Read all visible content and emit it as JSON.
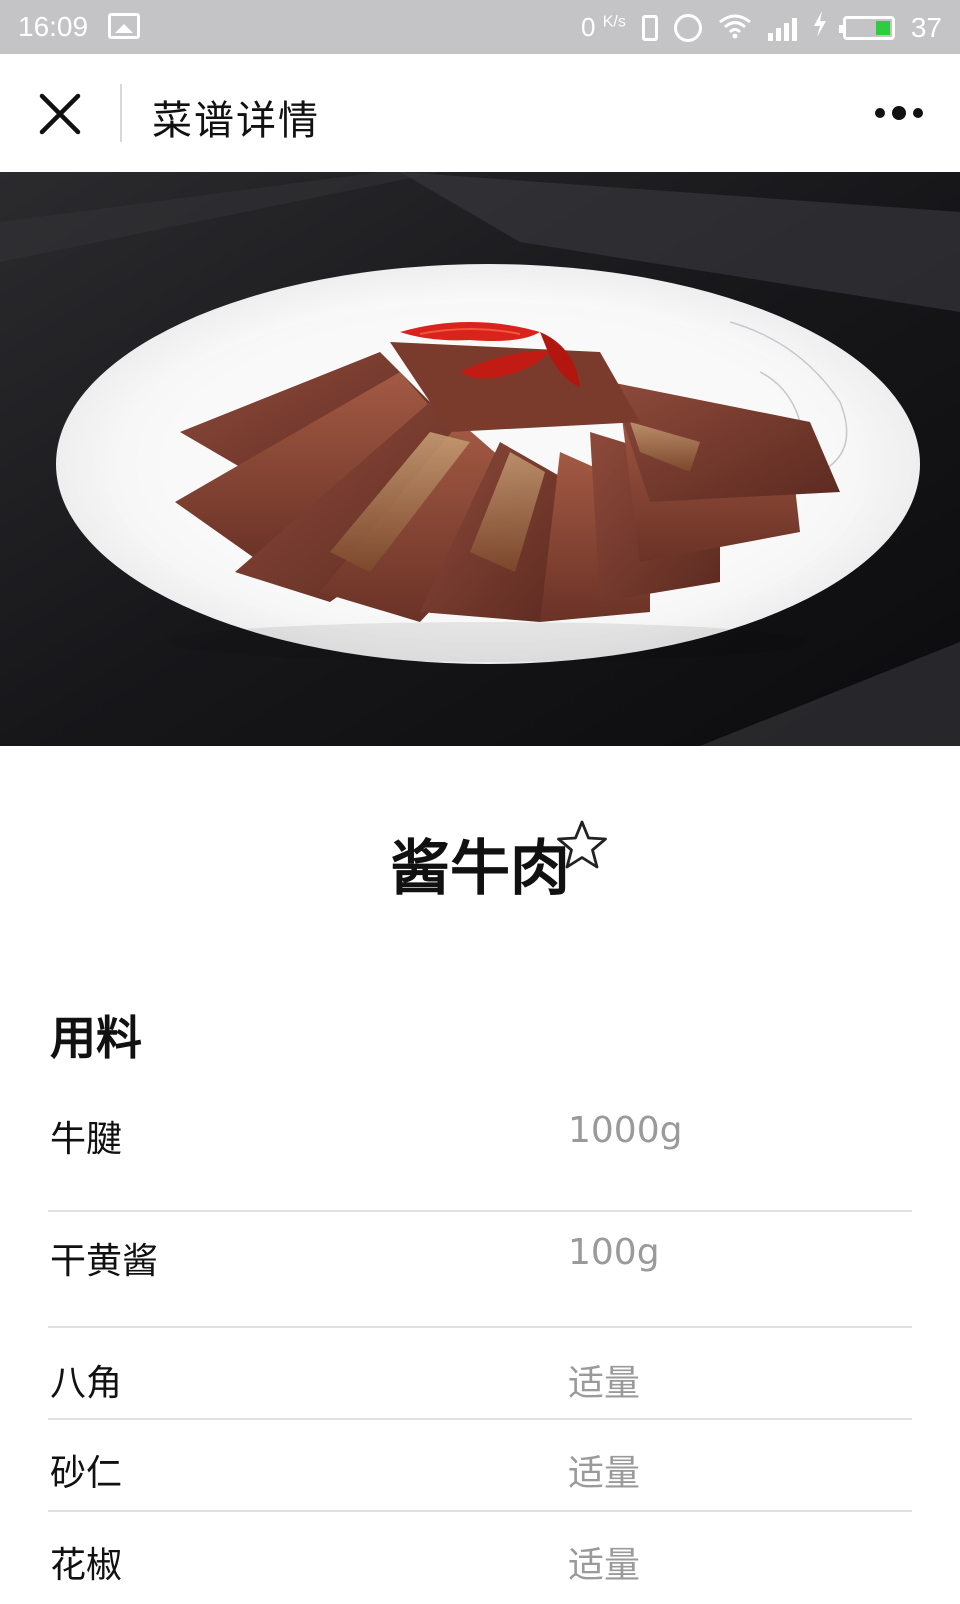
{
  "status_bar": {
    "time": "16:09",
    "net_speed": "0",
    "net_speed_unit": "K/s",
    "battery_level": "37",
    "icons": [
      "image-icon",
      "vibrate-icon",
      "alarm-icon",
      "wifi-icon",
      "signal-4g-icon",
      "charging-icon",
      "battery-icon"
    ]
  },
  "nav": {
    "title": "菜谱详情",
    "close_icon": "close-icon",
    "more_icon": "more-dots-icon"
  },
  "hero": {
    "image": "braised-beef-slices-photo"
  },
  "recipe": {
    "title": "酱牛肉",
    "favorite_icon": "star-outline-icon"
  },
  "ingredients": {
    "heading": "用料",
    "items": [
      {
        "name": "牛腱",
        "amount": "1000g"
      },
      {
        "name": "干黄酱",
        "amount": "100g"
      },
      {
        "name": "八角",
        "amount": "适量"
      },
      {
        "name": "砂仁",
        "amount": "适量"
      },
      {
        "name": "花椒",
        "amount": "适量"
      }
    ]
  },
  "colors": {
    "status_bar_bg": "#c4c4c6",
    "amount_text": "#9a9a9a",
    "divider": "#e0e0e0",
    "battery_fill": "#2ecc40"
  }
}
